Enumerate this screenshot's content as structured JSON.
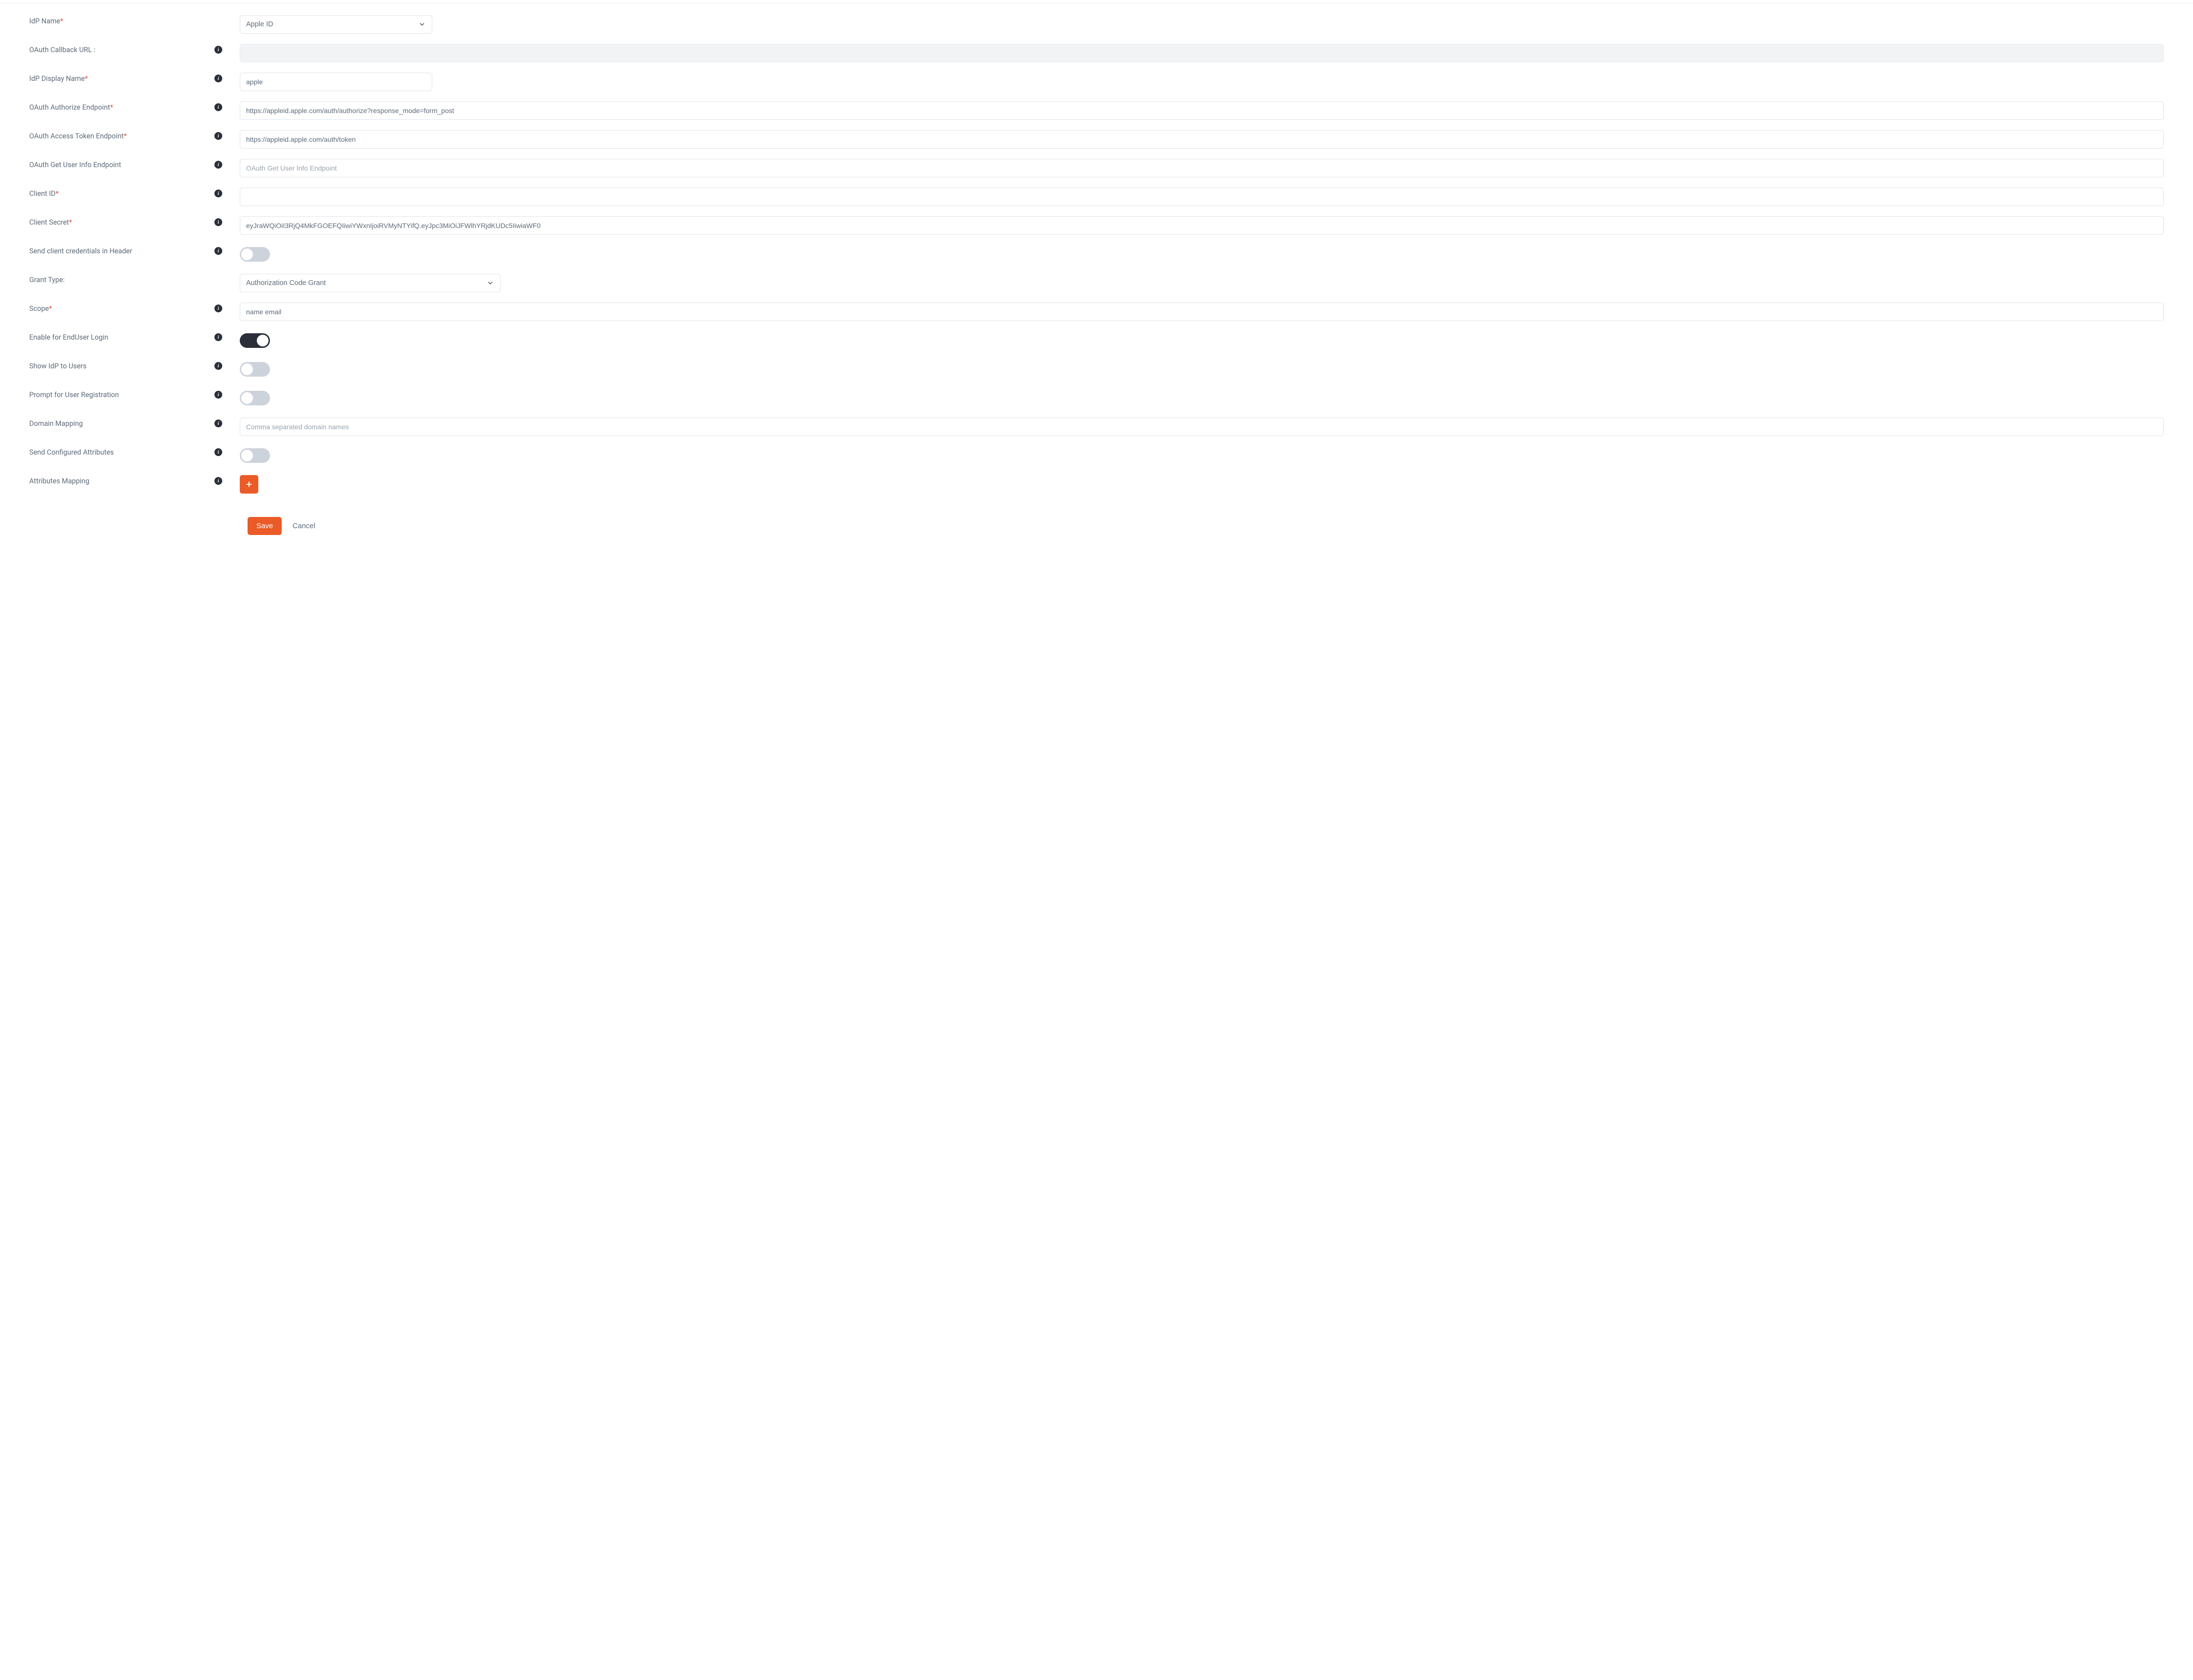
{
  "labels": {
    "idp_name": "IdP Name",
    "callback_url": "OAuth Callback URL :",
    "display_name": "IdP Display Name",
    "authorize_ep": "OAuth Authorize Endpoint",
    "token_ep": "OAuth Access Token Endpoint",
    "userinfo_ep": "OAuth Get User Info Endpoint",
    "client_id": "Client ID",
    "client_secret": "Client Secret",
    "creds_header": "Send client credentials in Header",
    "grant_type": "Grant Type:",
    "scope": "Scope",
    "enable_enduser": "Enable for EndUser Login",
    "show_idp": "Show IdP to Users",
    "prompt_reg": "Prompt for User Registration",
    "domain_mapping": "Domain Mapping",
    "send_attrs": "Send Configured Attributes",
    "attrs_mapping": "Attributes Mapping"
  },
  "values": {
    "idp_name": "Apple ID",
    "callback_url": "",
    "display_name": "apple",
    "authorize_ep": "https://appleid.apple.com/auth/authorize?response_mode=form_post",
    "token_ep": "https://appleid.apple.com/auth/token",
    "userinfo_ep": "",
    "client_id": "",
    "client_secret": "eyJraWQiOiI3RjQ4MkFGOEFQIiwiYWxnIjoiRVMyNTYifQ.eyJpc3MiOiJFWlhYRjdKUDc5IiwiaWF0",
    "grant_type": "Authorization Code Grant",
    "scope": "name email",
    "domain_mapping": ""
  },
  "placeholders": {
    "userinfo_ep": "OAuth Get User Info Endpoint",
    "domain_mapping": "Comma separated domain names"
  },
  "toggles": {
    "creds_header": false,
    "enable_enduser": true,
    "show_idp": false,
    "prompt_reg": false,
    "send_attrs": false
  },
  "actions": {
    "save": "Save",
    "cancel": "Cancel"
  },
  "required_marker": "*",
  "info_glyph": "i"
}
